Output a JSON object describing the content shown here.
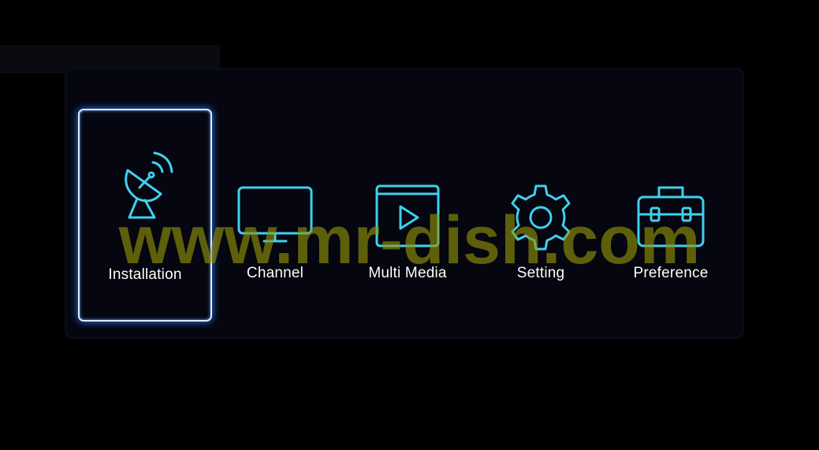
{
  "menu": {
    "items": [
      {
        "label": "Installation",
        "icon": "satellite-dish-icon",
        "selected": true
      },
      {
        "label": "Channel",
        "icon": "tv-icon",
        "selected": false
      },
      {
        "label": "Multi Media",
        "icon": "media-player-icon",
        "selected": false
      },
      {
        "label": "Setting",
        "icon": "gear-icon",
        "selected": false
      },
      {
        "label": "Preference",
        "icon": "toolbox-icon",
        "selected": false
      }
    ]
  },
  "watermark": {
    "text": "www.mr-dish.com"
  },
  "colors": {
    "background": "#000000",
    "panel": "#05060f",
    "icon_stroke": "#3fd0ee",
    "selection_border": "#dfe9ff",
    "selection_glow": "#2f7bff",
    "label": "#ffffff",
    "watermark": "#969610"
  }
}
